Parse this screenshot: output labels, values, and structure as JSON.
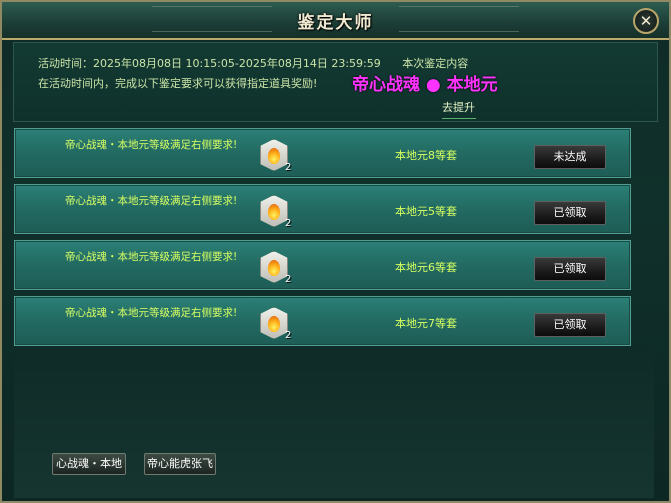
{
  "window": {
    "title": "鉴定大师",
    "close_label": "✕"
  },
  "info": {
    "label": "活动时间：",
    "time_range": "2025年08月08日 10:15:05-2025年08月14日 23:59:59",
    "content_label": "本次鉴定内容",
    "desc": "在活动时间内，完成以下鉴定要求可以获得指定道具奖励!",
    "hero_name": "帝心战魂 ● 本地元",
    "upgrade_link": "去提升"
  },
  "rows": [
    {
      "desc": "帝心战魂・本地元等级满足右侧要求!",
      "count": "2",
      "requirement": "本地元8等套",
      "button": "未达成"
    },
    {
      "desc": "帝心战魂・本地元等级满足右侧要求!",
      "count": "2",
      "requirement": "本地元5等套",
      "button": "已领取"
    },
    {
      "desc": "帝心战魂・本地元等级满足右侧要求!",
      "count": "2",
      "requirement": "本地元6等套",
      "button": "已领取"
    },
    {
      "desc": "帝心战魂・本地元等级满足右侧要求!",
      "count": "2",
      "requirement": "本地元7等套",
      "button": "已领取"
    }
  ],
  "bottom": {
    "tab1": "心战魂・本地",
    "tab2": "帝心能虎张飞"
  },
  "colors": {
    "accent": "#ff33ff",
    "text_green": "#d8ff61",
    "row_bg": "#226a62",
    "frame": "#b9a96b"
  }
}
